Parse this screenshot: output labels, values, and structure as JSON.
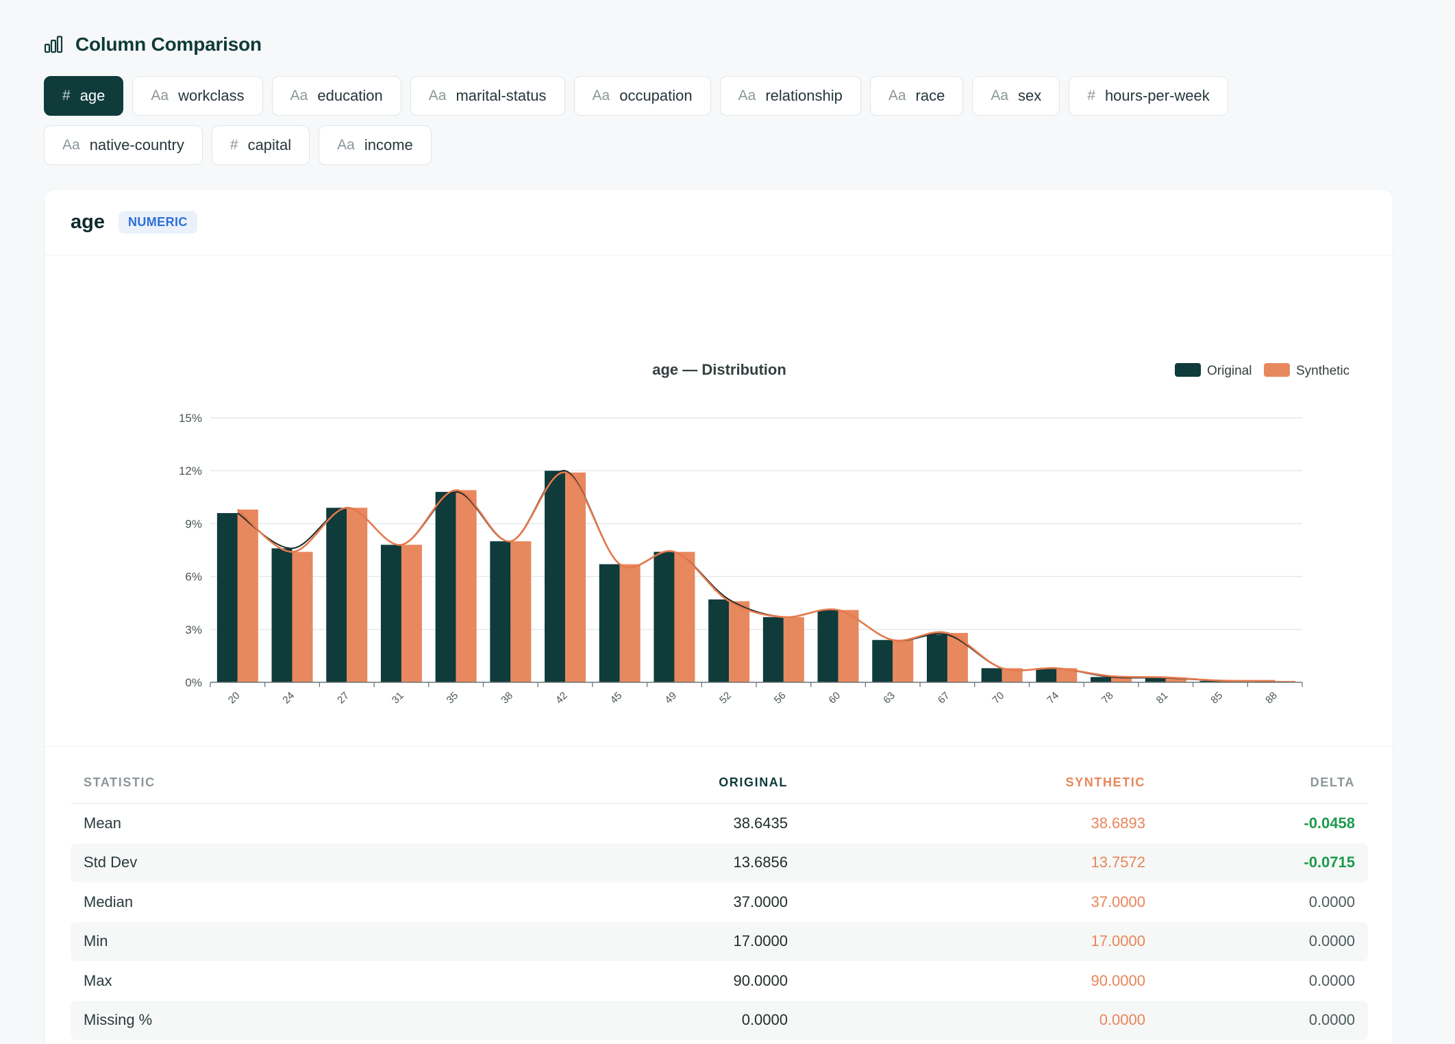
{
  "header": {
    "title": "Column Comparison",
    "icon": "bar-chart-icon"
  },
  "columns": [
    {
      "label": "age",
      "icon": "#",
      "active": true
    },
    {
      "label": "workclass",
      "icon": "Aa",
      "active": false
    },
    {
      "label": "education",
      "icon": "Aa",
      "active": false
    },
    {
      "label": "marital-status",
      "icon": "Aa",
      "active": false
    },
    {
      "label": "occupation",
      "icon": "Aa",
      "active": false
    },
    {
      "label": "relationship",
      "icon": "Aa",
      "active": false
    },
    {
      "label": "race",
      "icon": "Aa",
      "active": false
    },
    {
      "label": "sex",
      "icon": "Aa",
      "active": false
    },
    {
      "label": "hours-per-week",
      "icon": "#",
      "active": false
    },
    {
      "label": "native-country",
      "icon": "Aa",
      "active": false
    },
    {
      "label": "capital",
      "icon": "#",
      "active": false
    },
    {
      "label": "income",
      "icon": "Aa",
      "active": false
    }
  ],
  "card": {
    "column_name": "age",
    "type_badge": "NUMERIC"
  },
  "chart_data": {
    "type": "bar",
    "title": "age — Distribution",
    "xlabel": "",
    "ylabel": "",
    "categories": [
      "20",
      "24",
      "27",
      "31",
      "35",
      "38",
      "42",
      "45",
      "49",
      "52",
      "56",
      "60",
      "63",
      "67",
      "70",
      "74",
      "78",
      "81",
      "85",
      "88"
    ],
    "series": [
      {
        "name": "Original",
        "color": "#0f3b3b",
        "values": [
          9.6,
          7.6,
          9.9,
          7.8,
          10.8,
          8.0,
          12.0,
          6.7,
          7.4,
          4.7,
          3.7,
          4.1,
          2.4,
          2.7,
          0.8,
          0.8,
          0.3,
          0.25,
          0.08,
          0.08
        ]
      },
      {
        "name": "Synthetic",
        "color": "#e8885e",
        "values": [
          9.8,
          7.4,
          9.9,
          7.8,
          10.9,
          8.0,
          11.9,
          6.7,
          7.4,
          4.6,
          3.7,
          4.1,
          2.4,
          2.8,
          0.8,
          0.8,
          0.35,
          0.28,
          0.1,
          0.08
        ]
      }
    ],
    "yticks": [
      "0%",
      "3%",
      "6%",
      "9%",
      "12%",
      "15%"
    ],
    "ylim": [
      0,
      15
    ],
    "legend_position": "top-right",
    "grid": true
  },
  "stats": {
    "headers": [
      "STATISTIC",
      "ORIGINAL",
      "SYNTHETIC",
      "DELTA"
    ],
    "rows": [
      {
        "statistic": "Mean",
        "original": "38.6435",
        "synthetic": "38.6893",
        "delta": "-0.0458",
        "highlight": true
      },
      {
        "statistic": "Std Dev",
        "original": "13.6856",
        "synthetic": "13.7572",
        "delta": "-0.0715",
        "highlight": true
      },
      {
        "statistic": "Median",
        "original": "37.0000",
        "synthetic": "37.0000",
        "delta": "0.0000",
        "highlight": false
      },
      {
        "statistic": "Min",
        "original": "17.0000",
        "synthetic": "17.0000",
        "delta": "0.0000",
        "highlight": false
      },
      {
        "statistic": "Max",
        "original": "90.0000",
        "synthetic": "90.0000",
        "delta": "0.0000",
        "highlight": false
      },
      {
        "statistic": "Missing %",
        "original": "0.0000",
        "synthetic": "0.0000",
        "delta": "0.0000",
        "highlight": false
      }
    ]
  }
}
